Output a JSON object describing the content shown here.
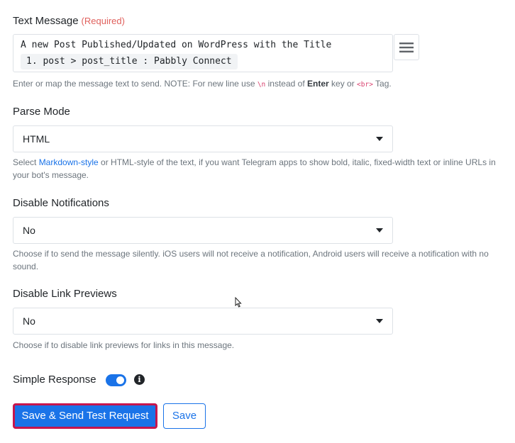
{
  "text_message": {
    "label": "Text Message",
    "required": "(Required)",
    "line1": "A new Post Published/Updated on WordPress with the Title",
    "mapped_chip": "1. post > post_title : Pabbly Connect",
    "menu_icon": "hamburger-menu-icon",
    "help": {
      "part1": "Enter or map the message text to send. NOTE: For new line use ",
      "code1": "\\n",
      "part2": " instead of ",
      "bold": "Enter",
      "part3": " key or ",
      "code2": "<br>",
      "part4": " Tag."
    }
  },
  "parse_mode": {
    "label": "Parse Mode",
    "value": "HTML",
    "help": {
      "part1": "Select ",
      "link": "Markdown-style",
      "part2": " or HTML-style of the text, if you want Telegram apps to show bold, italic, fixed-width text or inline URLs in your bot's message."
    }
  },
  "disable_notifications": {
    "label": "Disable Notifications",
    "value": "No",
    "help": "Choose if to send the message silently. iOS users will not receive a notification, Android users will receive a notification with no sound."
  },
  "disable_link_previews": {
    "label": "Disable Link Previews",
    "value": "No",
    "help": "Choose if to disable link previews for links in this message."
  },
  "simple_response": {
    "label": "Simple Response",
    "enabled": true,
    "info_icon": "info-icon"
  },
  "buttons": {
    "save_send": "Save & Send Test Request",
    "save": "Save"
  },
  "colors": {
    "primary": "#1a73e8",
    "required": "#e0615d",
    "highlight_border": "#c6164d",
    "help_text": "#6c757d"
  }
}
